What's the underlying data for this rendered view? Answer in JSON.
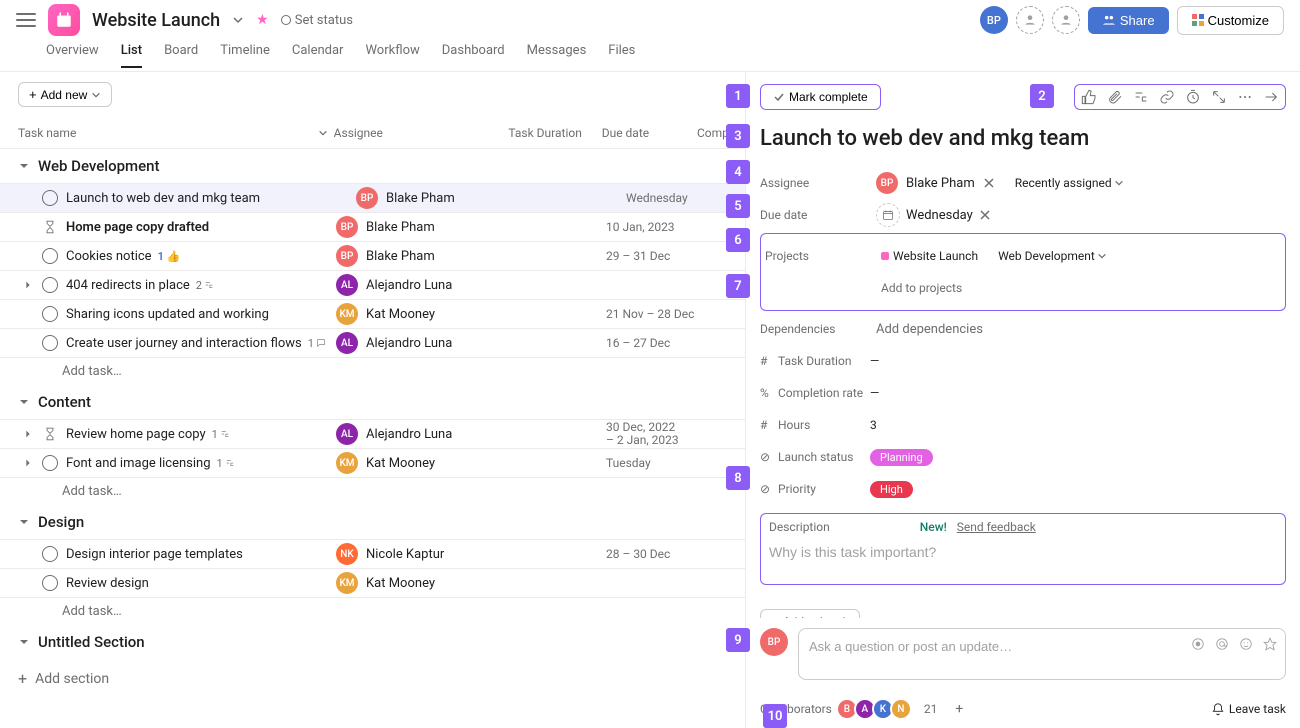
{
  "header": {
    "project_title": "Website Launch",
    "set_status": "Set status",
    "share": "Share",
    "customize": "Customize"
  },
  "nav": {
    "tabs": [
      "Overview",
      "List",
      "Board",
      "Timeline",
      "Calendar",
      "Workflow",
      "Dashboard",
      "Messages",
      "Files"
    ],
    "active": "List"
  },
  "list": {
    "add_new": "Add new",
    "columns": {
      "task_name": "Task name",
      "assignee": "Assignee",
      "task_duration": "Task Duration",
      "due_date": "Due date",
      "completion": "Comple"
    },
    "add_task": "Add task…",
    "add_section": "Add section",
    "sections": [
      {
        "name": "Web Development",
        "tasks": [
          {
            "name": "Launch to web dev and mkg team",
            "assignee": "Blake Pham",
            "avatar_color": "#f06a6a",
            "due": "Wednesday",
            "selected": true,
            "check": true
          },
          {
            "name": "Home page copy drafted",
            "assignee": "Blake Pham",
            "avatar_color": "#f06a6a",
            "due": "10 Jan, 2023",
            "bold": true,
            "icon": "hourglass"
          },
          {
            "name": "Cookies notice",
            "assignee": "Blake Pham",
            "avatar_color": "#f06a6a",
            "due": "29 – 31 Dec",
            "check": true,
            "likes": "1"
          },
          {
            "name": "404 redirects in place",
            "assignee": "Alejandro Luna",
            "avatar_color": "#8e24aa",
            "due": "",
            "check": true,
            "expand": true,
            "subtask_badge": "2"
          },
          {
            "name": "Sharing icons updated and working",
            "assignee": "Kat Mooney",
            "avatar_color": "#e8a33d",
            "due": "21 Nov – 28 Dec",
            "check": true
          },
          {
            "name": "Create user journey and interaction flows",
            "assignee": "Alejandro Luna",
            "avatar_color": "#8e24aa",
            "due": "16 – 27 Dec",
            "check": true,
            "comment_badge": "1"
          }
        ]
      },
      {
        "name": "Content",
        "tasks": [
          {
            "name": "Review home page copy",
            "assignee": "Alejandro Luna",
            "avatar_color": "#8e24aa",
            "due": "30 Dec, 2022 – 2 Jan, 2023",
            "expand": true,
            "icon": "hourglass",
            "subtask_badge": "1"
          },
          {
            "name": "Font and image licensing",
            "assignee": "Kat Mooney",
            "avatar_color": "#e8a33d",
            "due": "Tuesday",
            "expand": true,
            "check": true,
            "subtask_badge": "1"
          }
        ]
      },
      {
        "name": "Design",
        "tasks": [
          {
            "name": "Design interior page templates",
            "assignee": "Nicole Kaptur",
            "avatar_color": "#ff6b35",
            "due": "28 – 30 Dec",
            "check": true
          },
          {
            "name": "Review design",
            "assignee": "Kat Mooney",
            "avatar_color": "#e8a33d",
            "due": "",
            "check": true
          }
        ]
      },
      {
        "name": "Untitled Section",
        "tasks": []
      }
    ]
  },
  "detail": {
    "mark_complete": "Mark complete",
    "title": "Launch to web dev and mkg team",
    "assignee_label": "Assignee",
    "assignee_name": "Blake Pham",
    "recently_assigned": "Recently assigned",
    "due_label": "Due date",
    "due_value": "Wednesday",
    "projects_label": "Projects",
    "project_name": "Website Launch",
    "project_section": "Web Development",
    "add_to_projects": "Add to projects",
    "dependencies_label": "Dependencies",
    "dependencies_value": "Add dependencies",
    "custom_fields": [
      {
        "icon": "#",
        "label": "Task Duration",
        "value": "—"
      },
      {
        "icon": "%",
        "label": "Completion rate",
        "value": "—"
      },
      {
        "icon": "#",
        "label": "Hours",
        "value": "3"
      },
      {
        "icon": "⊘",
        "label": "Launch status",
        "pill": "Planning",
        "pill_class": "pill-planning"
      },
      {
        "icon": "⊘",
        "label": "Priority",
        "pill": "High",
        "pill_class": "pill-high"
      }
    ],
    "description_label": "Description",
    "description_new": "New!",
    "description_feedback": "Send feedback",
    "description_placeholder": "Why is this task important?",
    "add_subtask": "Add subtask",
    "comment_placeholder": "Ask a question or post an update…",
    "collaborators_label": "Collaborators",
    "collaborators_count": "21",
    "leave_task": "Leave task"
  },
  "tags": [
    "1",
    "2",
    "3",
    "4",
    "5",
    "6",
    "7",
    "8",
    "9",
    "10"
  ]
}
